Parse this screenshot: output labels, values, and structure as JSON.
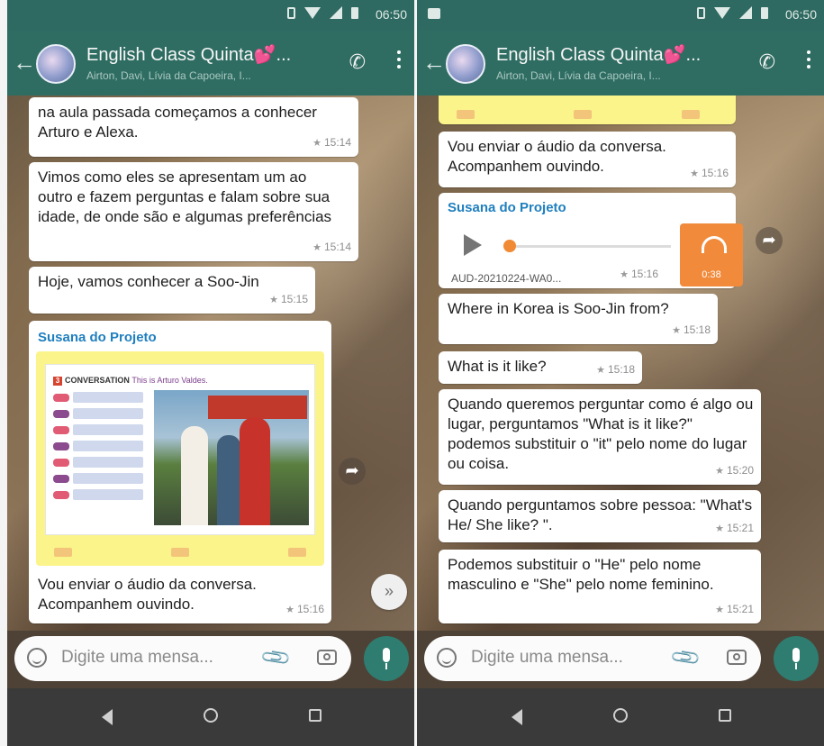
{
  "header": {
    "time": "06:50",
    "title": "English Class Quinta💕...",
    "subtitle": "Airton, Davi, Lívia da Capoeira, I..."
  },
  "left": {
    "messages": [
      {
        "text": "na aula passada começamos a conhecer Arturo e Alexa.",
        "time": "15:14"
      },
      {
        "text": "Vimos como eles se apresentam um ao outro e fazem perguntas e falam sobre sua idade, de onde são e algumas preferências",
        "time": "15:14"
      },
      {
        "text": "Hoje, vamos conhecer a Soo-Jin",
        "time": "15:15"
      }
    ],
    "image_message": {
      "sender": "Susana do Projeto",
      "slide_header": "CONVERSATION",
      "slide_subheader": "This is Arturo Valdes.",
      "caption": "Vou enviar o áudio da conversa. Acompanhem ouvindo.",
      "time": "15:16"
    }
  },
  "right": {
    "caption_top": {
      "text": "Vou enviar o áudio da conversa. Acompanhem ouvindo.",
      "time": "15:16"
    },
    "audio": {
      "sender": "Susana do Projeto",
      "filename": "AUD-20210224-WA0...",
      "time": "15:16",
      "duration": "0:38"
    },
    "messages": [
      {
        "text": "Where in Korea is Soo-Jin from?",
        "time": "15:18"
      },
      {
        "text": "What is it like?",
        "time": "15:18"
      },
      {
        "text": "Quando queremos perguntar como é algo ou lugar, perguntamos \"What is it like?\" podemos substituir o \"it\" pelo nome do lugar ou coisa.",
        "time": "15:20"
      },
      {
        "text": "Quando perguntamos sobre pessoa: \"What's He/ She like? \".",
        "time": "15:21"
      },
      {
        "text": "Podemos substituir o \"He\" pelo nome masculino e \"She\" pelo nome feminino.",
        "time": "15:21"
      }
    ]
  },
  "composer": {
    "placeholder": "Digite uma mensa..."
  },
  "icons": {
    "back": "back-arrow-icon",
    "call": "add-call-icon",
    "menu": "more-vert-icon",
    "emoji": "emoji-icon",
    "attach": "paperclip-icon",
    "camera": "camera-icon",
    "mic": "mic-icon",
    "forward": "forward-icon",
    "scroll": "double-chevron-down-icon",
    "star": "star-icon",
    "play": "play-icon",
    "headset": "headphones-icon"
  },
  "colors": {
    "header": "#2f6d63",
    "accent": "#2f7d70",
    "sender": "#1f7fbf",
    "audio": "#f18a3b"
  }
}
